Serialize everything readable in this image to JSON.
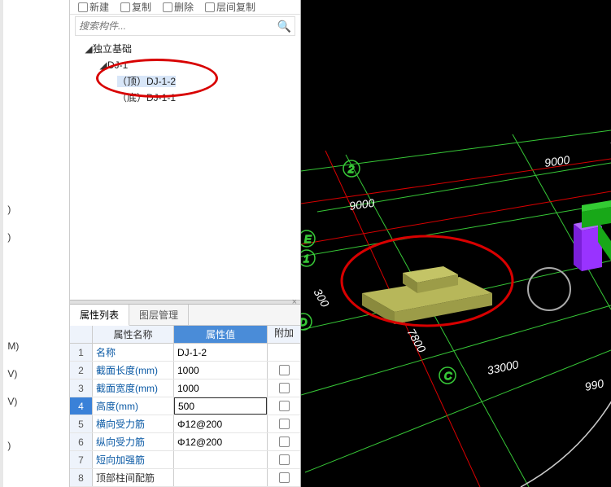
{
  "toolbar": {
    "new": "新建",
    "copy": "复制",
    "delete": "删除",
    "interlayer": "层间复制"
  },
  "search": {
    "placeholder": "搜索构件..."
  },
  "tree": {
    "root": "独立基础",
    "child": "DJ-1",
    "leaf1": "（顶）DJ-1-2",
    "leaf2": "（底）DJ-1-1"
  },
  "tabs": {
    "props": "属性列表",
    "layers": "图层管理"
  },
  "prop_header": {
    "name": "属性名称",
    "value": "属性值",
    "extra": "附加"
  },
  "props": [
    {
      "num": "1",
      "name": "名称",
      "value": "DJ-1-2",
      "link": true,
      "editing": false,
      "chk": false
    },
    {
      "num": "2",
      "name": "截面长度(mm)",
      "value": "1000",
      "link": true,
      "editing": false,
      "chk": true
    },
    {
      "num": "3",
      "name": "截面宽度(mm)",
      "value": "1000",
      "link": true,
      "editing": false,
      "chk": true
    },
    {
      "num": "4",
      "name": "高度(mm)",
      "value": "500",
      "link": true,
      "editing": true,
      "chk": true
    },
    {
      "num": "5",
      "name": "横向受力筋",
      "value": "Φ12@200",
      "link": true,
      "editing": false,
      "chk": true
    },
    {
      "num": "6",
      "name": "纵向受力筋",
      "value": "Φ12@200",
      "link": true,
      "editing": false,
      "chk": true
    },
    {
      "num": "7",
      "name": "短向加强筋",
      "value": "",
      "link": true,
      "editing": false,
      "chk": true
    },
    {
      "num": "8",
      "name": "顶部柱间配筋",
      "value": "",
      "link": false,
      "editing": false,
      "chk": true
    }
  ],
  "left_stubs": [
    ")",
    ")",
    "M)",
    "V)",
    "V)",
    ")"
  ],
  "viewport": {
    "axes": [
      "2",
      "E",
      "1",
      "D",
      "C"
    ],
    "dims": [
      "9000",
      "9000",
      "300",
      "7800",
      "33000",
      "990"
    ]
  }
}
